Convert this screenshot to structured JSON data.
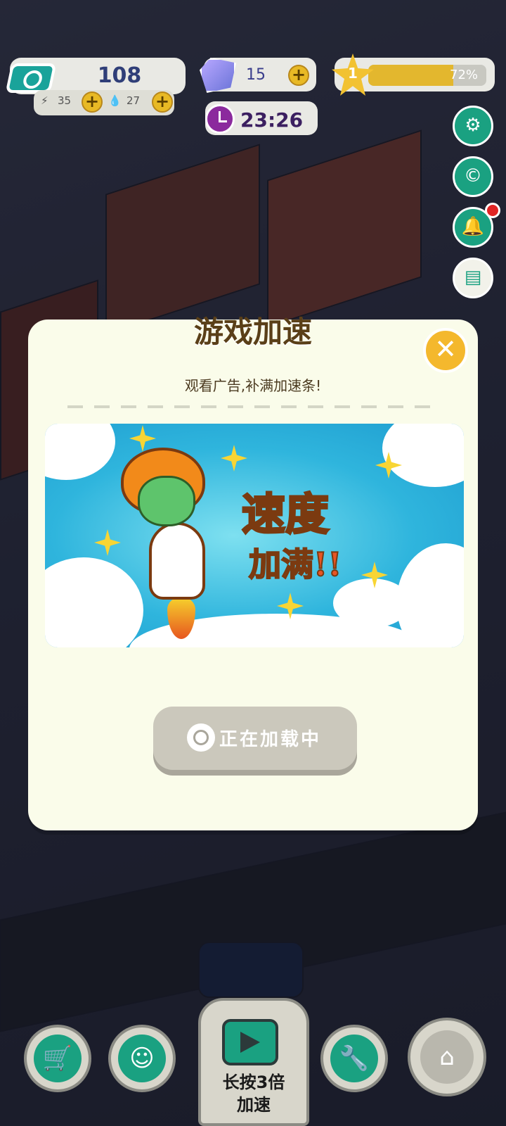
{
  "hud": {
    "money": "108",
    "energy": "35",
    "water": "27",
    "gems": "15",
    "level": "1",
    "level_percent": "72%",
    "level_progress": 0.72,
    "timer": "23:26"
  },
  "side_buttons": [
    "gear-icon",
    "c-icon",
    "bell-icon",
    "notes-icon",
    "gift-icon"
  ],
  "dialog": {
    "title": "游戏加速",
    "subtitle": "观看广告,补满加速条!",
    "banner_line1": "速度",
    "banner_line2": "加满!!",
    "loading_label": "正在加载中",
    "close_glyph": "✕"
  },
  "bottom_nav": {
    "center_label_line1": "长按3倍",
    "center_label_line2": "加速"
  },
  "colors": {
    "dialog_bg": "#fafcea",
    "accent_green": "#1aa181",
    "close_yellow": "#f4b82d",
    "title_brown": "#5a3f18"
  }
}
